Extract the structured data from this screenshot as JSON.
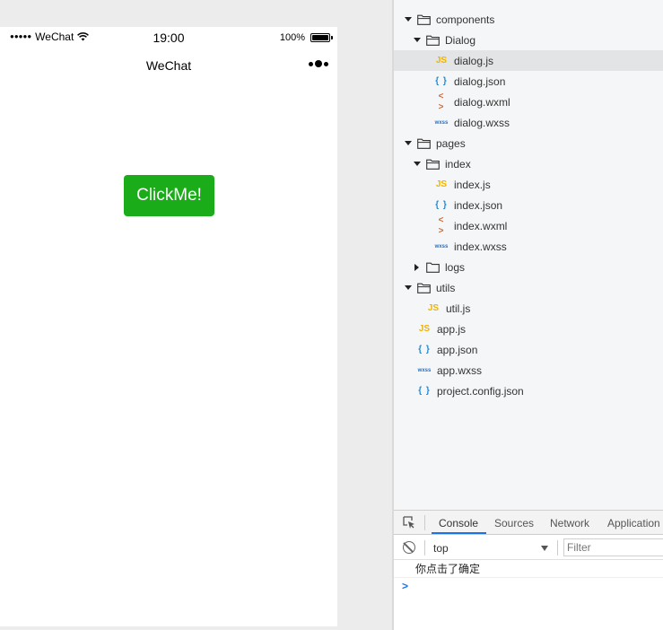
{
  "simulator": {
    "status": {
      "signal": "●●●●●",
      "carrier": "WeChat",
      "time": "19:00",
      "battery": "100%"
    },
    "nav_title": "WeChat",
    "button_label": "ClickMe!",
    "button_color": "#1aad19"
  },
  "tree": [
    {
      "label": "components",
      "kind": "folder",
      "expanded": true
    },
    {
      "label": "Dialog",
      "kind": "folder",
      "expanded": true
    },
    {
      "label": "dialog.js",
      "kind": "js",
      "icon": "JS",
      "selected": true
    },
    {
      "label": "dialog.json",
      "kind": "json",
      "icon": "{ }"
    },
    {
      "label": "dialog.wxml",
      "kind": "wxml",
      "icon": "< >"
    },
    {
      "label": "dialog.wxss",
      "kind": "wxss",
      "icon": "wxss"
    },
    {
      "label": "pages",
      "kind": "folder",
      "expanded": true
    },
    {
      "label": "index",
      "kind": "folder",
      "expanded": true
    },
    {
      "label": "index.js",
      "kind": "js",
      "icon": "JS"
    },
    {
      "label": "index.json",
      "kind": "json",
      "icon": "{ }"
    },
    {
      "label": "index.wxml",
      "kind": "wxml",
      "icon": "< >"
    },
    {
      "label": "index.wxss",
      "kind": "wxss",
      "icon": "wxss"
    },
    {
      "label": "logs",
      "kind": "folder",
      "expanded": false
    },
    {
      "label": "utils",
      "kind": "folder",
      "expanded": true
    },
    {
      "label": "util.js",
      "kind": "js",
      "icon": "JS"
    },
    {
      "label": "app.js",
      "kind": "js",
      "icon": "JS"
    },
    {
      "label": "app.json",
      "kind": "json",
      "icon": "{ }"
    },
    {
      "label": "app.wxss",
      "kind": "wxss",
      "icon": "wxss"
    },
    {
      "label": "project.config.json",
      "kind": "json",
      "icon": "{ }"
    }
  ],
  "devtools": {
    "tabs": [
      "Console",
      "Sources",
      "Network",
      "Application"
    ],
    "active_tab": "Console",
    "context": "top",
    "filter_placeholder": "Filter",
    "messages": [
      "你点击了确定"
    ],
    "prompt": ">"
  }
}
